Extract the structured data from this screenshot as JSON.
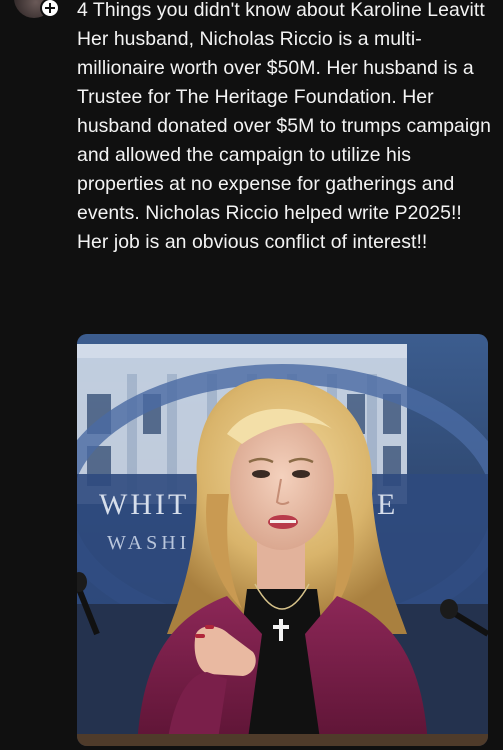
{
  "post": {
    "lines": [
      "4 Things you didn't know about Karoline Leavitt",
      "Her husband, Nicholas Riccio is a multi-millionaire worth over $50M. Her husband is a Trustee for The Heritage Foundation. Her husband donated over $5M to trumps campaign and allowed the campaign to utilize his properties at no expense for gatherings and events. Nicholas Riccio helped write P2025!!",
      "Her job is an obvious conflict of interest!!"
    ],
    "photo": {
      "seal_text_line1": "WHIT",
      "seal_text_line1b": "E",
      "seal_text_line2": "WASHI"
    }
  },
  "colors": {
    "background": "#101010",
    "text": "#f3f3f3",
    "blazer": "#7a1f4a",
    "seal_blue": "#2f4a7e"
  },
  "icons": {
    "avatar": "avatar",
    "follow_badge": "plus-icon"
  }
}
